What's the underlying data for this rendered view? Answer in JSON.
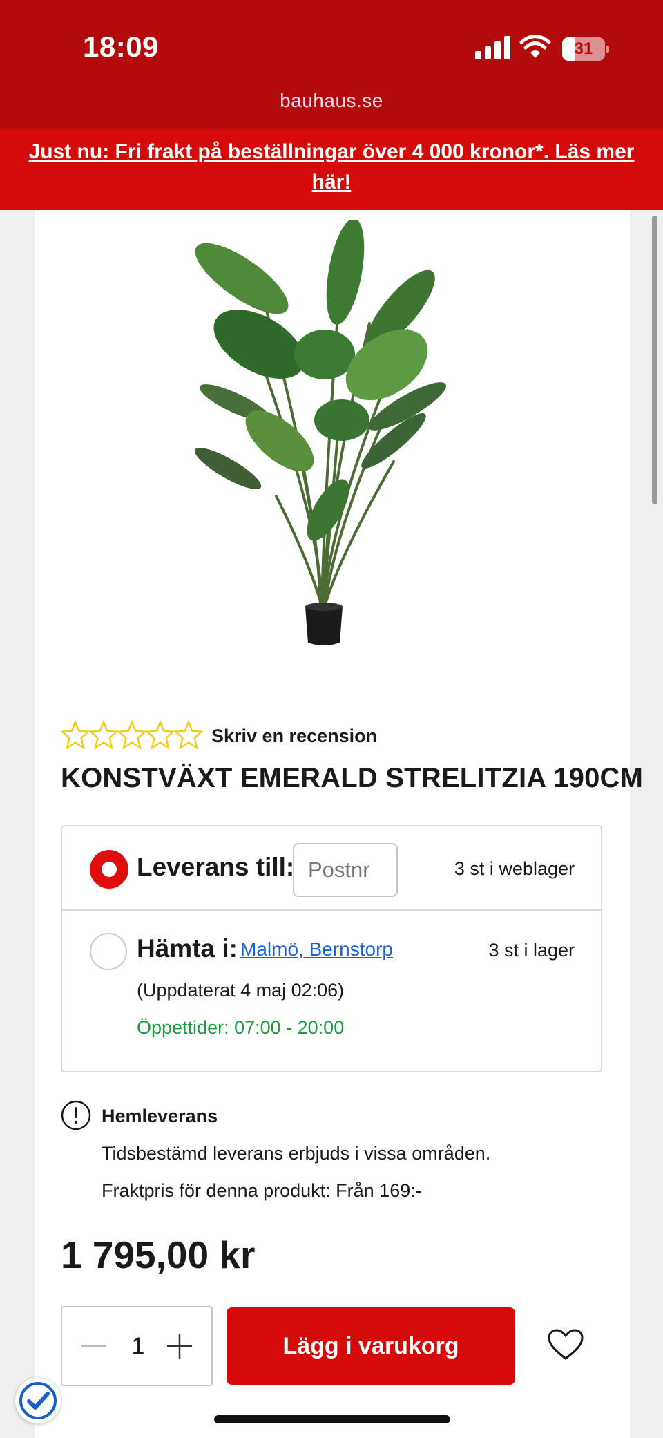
{
  "status_bar": {
    "time": "18:09",
    "battery": "31",
    "icons": [
      "signal-icon",
      "wifi-icon",
      "battery-icon"
    ]
  },
  "browser": {
    "url": "bauhaus.se"
  },
  "banner": {
    "text": "Just nu: Fri frakt på beställningar över 4 000 kronor*. Läs mer här!"
  },
  "product": {
    "rating_stars": 0,
    "rating_max": 5,
    "review_link": "Skriv en recension",
    "title": "KONSTVÄXT EMERALD STRELITZIA 190CM",
    "price": "1 795,00 kr"
  },
  "delivery_options": {
    "delivery": {
      "label": "Leverans till:",
      "postcode_placeholder": "Postnr",
      "stock": "3 st i weblager",
      "selected": true
    },
    "pickup": {
      "label": "Hämta i:",
      "store": "Malmö, Bernstorp",
      "stock": "3 st i lager",
      "updated": "(Uppdaterat 4 maj 02:06)",
      "hours": "Öppettider: 07:00 - 20:00",
      "selected": false
    }
  },
  "home_delivery": {
    "title": "Hemleverans",
    "line1": "Tidsbestämd leverans erbjuds i vissa områden.",
    "line2": "Fraktpris för denna produkt: Från 169:-"
  },
  "cart": {
    "quantity": "1",
    "add_label": "Lägg i varukorg"
  },
  "colors": {
    "brand_red": "#d50a0a",
    "status_red": "#b30b0b",
    "link_blue": "#1a62d6",
    "open_green": "#1b9b3f",
    "star_yellow": "#f5d31a"
  }
}
